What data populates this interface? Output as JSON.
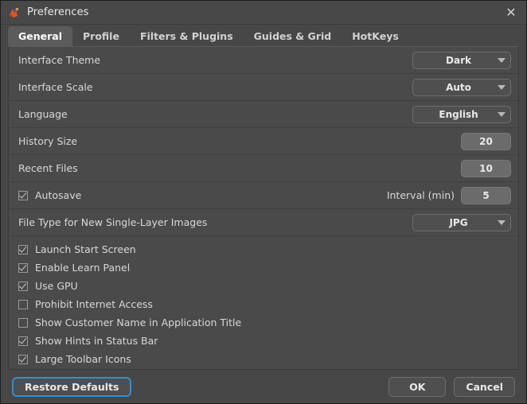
{
  "window": {
    "title": "Preferences",
    "app_icon": "app-logo-icon",
    "close_icon": "✕",
    "accent_color": "#2a90d8",
    "background_color": "#474747",
    "panel_color": "#4a4a4a"
  },
  "tabs": [
    {
      "label": "General",
      "active": true
    },
    {
      "label": "Profile",
      "active": false
    },
    {
      "label": "Filters & Plugins",
      "active": false
    },
    {
      "label": "Guides & Grid",
      "active": false
    },
    {
      "label": "HotKeys",
      "active": false
    }
  ],
  "settings": {
    "interface_theme": {
      "label": "Interface Theme",
      "value": "Dark"
    },
    "interface_scale": {
      "label": "Interface Scale",
      "value": "Auto"
    },
    "language": {
      "label": "Language",
      "value": "English"
    },
    "history_size": {
      "label": "History Size",
      "value": "20"
    },
    "recent_files": {
      "label": "Recent Files",
      "value": "10"
    },
    "autosave": {
      "label": "Autosave",
      "checked": true,
      "interval_label": "Interval (min)",
      "interval_value": "5"
    },
    "file_type": {
      "label": "File Type for New Single-Layer Images",
      "value": "JPG"
    }
  },
  "checkboxes": [
    {
      "label": "Launch Start Screen",
      "checked": true
    },
    {
      "label": "Enable Learn Panel",
      "checked": true
    },
    {
      "label": "Use GPU",
      "checked": true
    },
    {
      "label": "Prohibit Internet Access",
      "checked": false
    },
    {
      "label": "Show Customer Name in Application Title",
      "checked": false
    },
    {
      "label": "Show Hints in Status Bar",
      "checked": true
    },
    {
      "label": "Large Toolbar Icons",
      "checked": true
    }
  ],
  "footer": {
    "restore_defaults": "Restore Defaults",
    "ok": "OK",
    "cancel": "Cancel"
  }
}
